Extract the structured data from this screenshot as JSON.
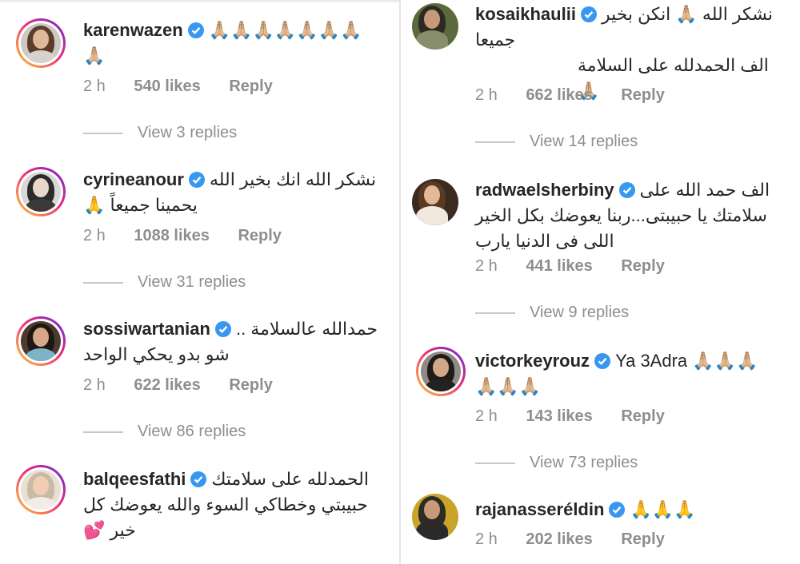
{
  "left": {
    "comments": [
      {
        "username": "karenwazen",
        "lines": [
          "🙏🏼🙏🏼🙏🏼🙏🏼🙏🏼🙏🏼🙏🏼",
          "🙏🏼"
        ],
        "time": "2 h",
        "likes": "540 likes",
        "reply": "Reply",
        "view_replies": "View 3 replies"
      },
      {
        "username": "cyrineanour",
        "lines": [
          "نشكر الله انك بخير الله",
          "يحمينا جميعاً 🙏"
        ],
        "time": "2 h",
        "likes": "1088 likes",
        "reply": "Reply",
        "view_replies": "View 31 replies"
      },
      {
        "username": "sossiwartanian",
        "lines": [
          "حمدالله عالسلامة ..",
          "شو بدو يحكي الواحد"
        ],
        "time": "2 h",
        "likes": "622 likes",
        "reply": "Reply",
        "view_replies": "View 86 replies"
      },
      {
        "username": "balqeesfathi",
        "lines": [
          "الحمدلله على سلامتك",
          "حبيبتي وخطاكي السوء والله يعوضك كل",
          "خير 💕"
        ],
        "time": "",
        "likes": "",
        "reply": "",
        "view_replies": ""
      }
    ]
  },
  "right": {
    "comments": [
      {
        "username": "kosaikhaulii",
        "lines": [
          "نشكر الله 🙏🏼 انكن بخير",
          "جميعا",
          "الف الحمدلله على السلامة 🙏🏼"
        ],
        "time": "2 h",
        "likes": "662 likes",
        "reply": "Reply",
        "view_replies": "View 14 replies"
      },
      {
        "username": "radwaelsherbiny",
        "lines": [
          "الف حمد الله على",
          "سلامتك يا حبيبتى...ربنا يعوضك بكل الخير",
          "اللى فى الدنيا يارب"
        ],
        "time": "2 h",
        "likes": "441 likes",
        "reply": "Reply",
        "view_replies": "View 9 replies"
      },
      {
        "username": "victorkeyrouz",
        "lines": [
          "Ya 3Adra 🙏🏼🙏🏼🙏🏼",
          "🙏🏼🙏🏼🙏🏼"
        ],
        "time": "2 h",
        "likes": "143 likes",
        "reply": "Reply",
        "view_replies": "View 73 replies"
      },
      {
        "username": "rajanasseréldin",
        "lines": [
          "🙏🙏🙏"
        ],
        "time": "2 h",
        "likes": "202 likes",
        "reply": "Reply",
        "view_replies": ""
      }
    ]
  },
  "colors": {
    "verified": "#3897f0",
    "muted": "#8e8e8e",
    "text": "#262626"
  }
}
